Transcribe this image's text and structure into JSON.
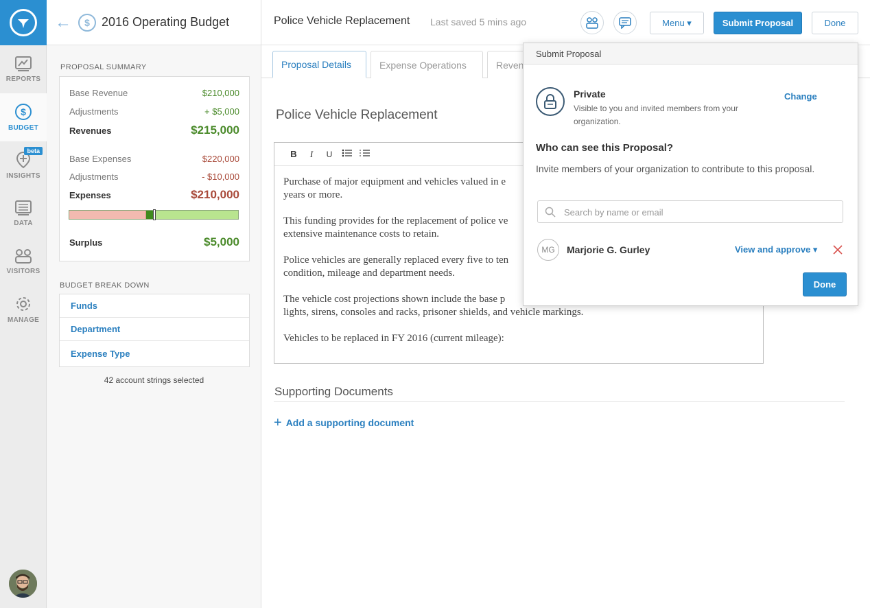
{
  "rail": {
    "items": [
      {
        "label": "REPORTS"
      },
      {
        "label": "BUDGET"
      },
      {
        "label": "INSIGHTS",
        "badge": "beta"
      },
      {
        "label": "DATA"
      },
      {
        "label": "VISITORS"
      },
      {
        "label": "MANAGE"
      }
    ],
    "accent": "#2b8fd1"
  },
  "left": {
    "budget_title": "2016 Operating Budget",
    "summary_title": "PROPOSAL SUMMARY",
    "summary": {
      "base_revenue_label": "Base Revenue",
      "base_revenue": "$210,000",
      "rev_adj_label": "Adjustments",
      "rev_adj": "+ $5,000",
      "revenues_label": "Revenues",
      "revenues": "$215,000",
      "base_expenses_label": "Base Expenses",
      "base_expenses": "$220,000",
      "exp_adj_label": "Adjustments",
      "exp_adj": "- $10,000",
      "expenses_label": "Expenses",
      "expenses": "$210,000",
      "surplus_label": "Surplus",
      "surplus": "$5,000"
    },
    "breakdown_title": "BUDGET BREAK DOWN",
    "breakdown": [
      "Funds",
      "Department",
      "Expense Type"
    ],
    "strings_selected": "42 account strings selected"
  },
  "header": {
    "title": "Police Vehicle Replacement",
    "saved": "Last saved 5 mins ago",
    "menu_label": "Menu ▾",
    "submit_label": "Submit Proposal",
    "done_label": "Done"
  },
  "tabs": [
    "Proposal Details",
    "Expense Operations",
    "Reven"
  ],
  "proposal": {
    "title": "Police Vehicle Replacement",
    "toolbar": [
      "B",
      "I",
      "U"
    ],
    "paragraphs": [
      "Purchase of major equipment and vehicles valued in e",
      "years or more.",
      "This funding provides for the replacement of police ve",
      "extensive maintenance costs to retain.",
      "Police vehicles are generally replaced every five to ten",
      "condition, mileage and department needs.",
      "The vehicle cost projections shown include the base p",
      "lights, sirens, consoles and racks, prisoner shields, and vehicle markings.",
      "Vehicles to be replaced in FY 2016 (current mileage):"
    ]
  },
  "supporting": {
    "title": "Supporting Documents",
    "add_label": "Add a supporting document"
  },
  "popover": {
    "title": "Submit Proposal",
    "privacy_title": "Private",
    "privacy_desc": "Visible to you and invited members from your organization.",
    "change_label": "Change",
    "who_title": "Who can see this Proposal?",
    "invite_text": "Invite members of your organization to contribute to this proposal.",
    "search_placeholder": "Search by name or email",
    "member": {
      "initials": "MG",
      "name": "Marjorie G. Gurley",
      "permission": "View and approve ▾"
    },
    "done_label": "Done"
  }
}
